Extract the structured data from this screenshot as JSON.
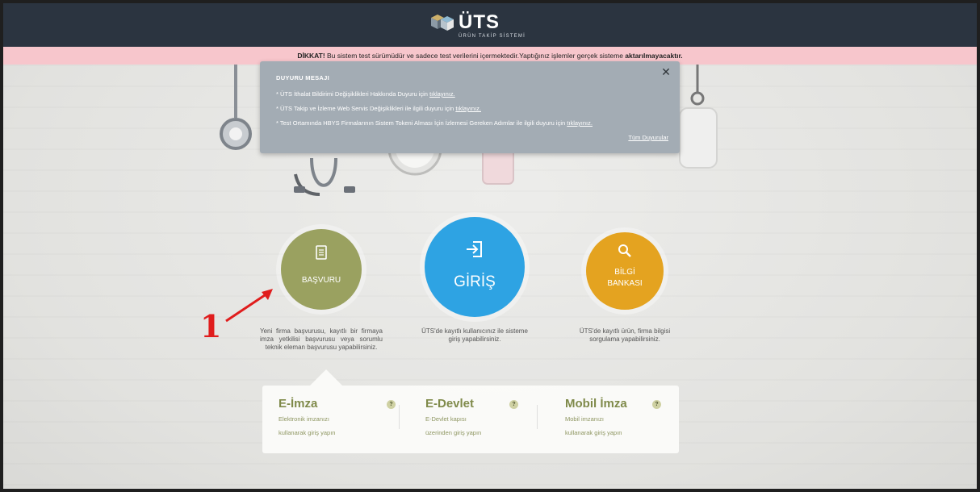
{
  "header": {
    "brand": "ÜTS",
    "subtitle": "ÜRÜN TAKİP SİSTEMİ"
  },
  "warning": {
    "prefix": "DİKKAT!",
    "text": " Bu sistem test sürümüdür ve sadece test verilerini içermektedir.Yaptığınız işlemler gerçek sisteme ",
    "bold_tail": "aktarılmayacaktır."
  },
  "notice": {
    "title": "DUYURU MESAJI",
    "close_symbol": "✕",
    "items": [
      {
        "text": "* ÜTS İthalat Bildirimi Değişiklikleri Hakkında Duyuru için ",
        "link": "tıklayınız."
      },
      {
        "text": "* ÜTS Takip ve İzleme Web Servis Değişiklikleri ile ilgili duyuru için ",
        "link": "tıklayınız."
      },
      {
        "text": "* Test Ortamında HBYS Firmalarının Sistem Tokeni Alması İçin İzlemesi Gereken Adımlar ile ilgili duyuru için ",
        "link": "tıklayınız."
      }
    ],
    "all_link": "Tüm Duyurular"
  },
  "actions": {
    "basvuru": {
      "label": "BAŞVURU",
      "description": "Yeni firma başvurusu, kayıtlı bir firmaya imza yetkilisi başvurusu veya sorumlu teknik eleman başvurusu yapabilirsiniz.",
      "color": "#9aa160",
      "icon": "document-icon"
    },
    "giris": {
      "label": "GİRİŞ",
      "description": "ÜTS'de kayıtlı kullanıcınız ile sisteme giriş yapabilirsiniz.",
      "color": "#2ea3e3",
      "icon": "login-icon"
    },
    "bilgi": {
      "label_line1": "BİLGİ",
      "label_line2": "BANKASI",
      "description": "ÜTS'de kayıtlı ürün, firma bilgisi sorgulama yapabilirsiniz.",
      "color": "#e4a320",
      "icon": "search-icon"
    }
  },
  "annotation": {
    "number": "1"
  },
  "login_options": [
    {
      "title": "E-İmza",
      "help": "?",
      "line1": "Elektronik imzanızı",
      "line2": "kullanarak giriş yapın"
    },
    {
      "title": "E-Devlet",
      "help": "?",
      "line1": "E-Devlet kapısı",
      "line2": "üzerinden giriş yapın"
    },
    {
      "title": "Mobil İmza",
      "help": "?",
      "line1": "Mobil imzanızı",
      "line2": "kullanarak giriş yapın"
    }
  ]
}
